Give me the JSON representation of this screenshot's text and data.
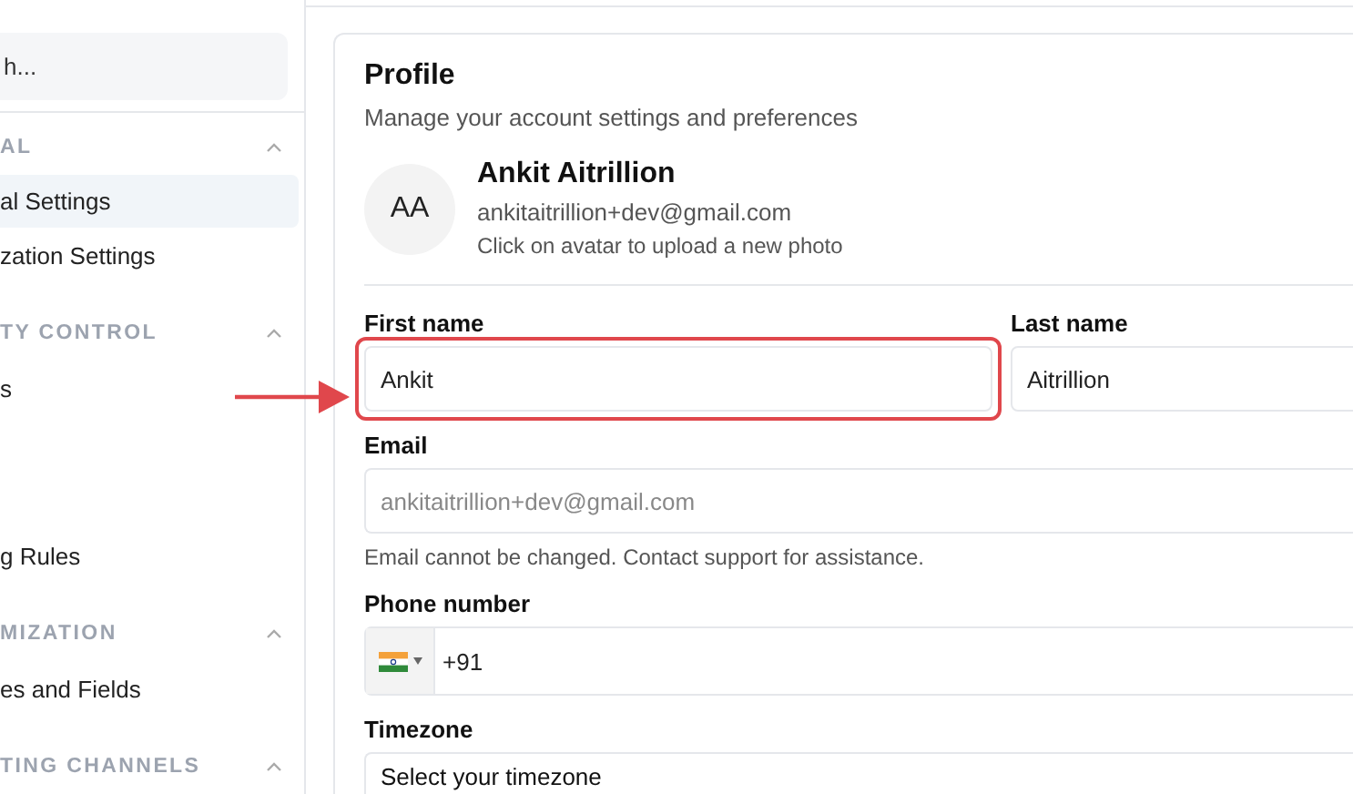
{
  "sidebar": {
    "search": {
      "placeholder": "h..."
    },
    "sections": [
      {
        "title": "AL",
        "expanded": true,
        "items": [
          {
            "label": "al Settings",
            "selected": true
          },
          {
            "label": "zation Settings",
            "selected": false
          }
        ]
      },
      {
        "title": "TY CONTROL",
        "expanded": true,
        "items": [
          {
            "label": "s",
            "selected": false
          },
          {
            "label": "g Rules",
            "selected": false
          }
        ]
      },
      {
        "title": "MIZATION",
        "expanded": true,
        "items": [
          {
            "label": "es and Fields",
            "selected": false
          }
        ]
      },
      {
        "title": "TING CHANNELS",
        "expanded": true
      }
    ]
  },
  "profile": {
    "title": "Profile",
    "subtitle": "Manage your account settings and preferences",
    "avatar": {
      "initials": "AA"
    },
    "name": "Ankit Aitrillion",
    "email": "ankitaitrillion+dev@gmail.com",
    "avatar_hint": "Click on avatar to upload a new photo",
    "first_name": {
      "label": "First name",
      "value": "Ankit",
      "highlighted": true
    },
    "last_name": {
      "label": "Last name",
      "value": "Aitrillion",
      "highlighted": false
    },
    "email_field": {
      "label": "Email",
      "value": "ankitaitrillion+dev@gmail.com",
      "disabled": true,
      "help": "Email cannot be changed. Contact support for assistance."
    },
    "phone": {
      "label": "Phone number",
      "dial_code": "+91"
    },
    "timezone": {
      "label": "Timezone",
      "value": "Select your timezone"
    }
  }
}
